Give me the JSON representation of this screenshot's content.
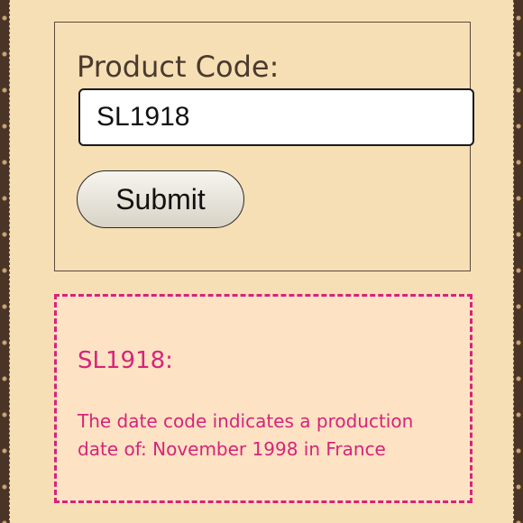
{
  "form": {
    "label": "Product Code:",
    "input_value": "SL1918",
    "submit_label": "Submit"
  },
  "result": {
    "title": "SL1918:",
    "message": "The date code indicates a production date of: November 1998 in France"
  },
  "colors": {
    "background": "#f6dfb5",
    "accent": "#d6247a",
    "border": "#5a4a3c"
  }
}
